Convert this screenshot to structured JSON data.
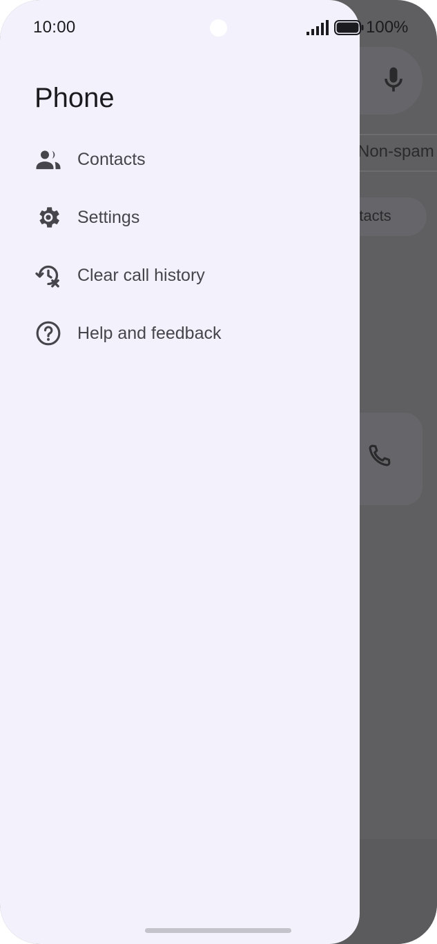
{
  "status_bar": {
    "time": "10:00",
    "battery": "100%",
    "icons": [
      "signal-icon",
      "battery-icon"
    ]
  },
  "background_app": {
    "filter_chip": "Non-spam",
    "contacts_chip": "ntacts",
    "icons": [
      "mic-icon",
      "phone-icon"
    ]
  },
  "drawer": {
    "title": "Phone",
    "items": [
      {
        "label": "Contacts",
        "icon": "contacts-icon"
      },
      {
        "label": "Settings",
        "icon": "gear-icon"
      },
      {
        "label": "Clear call history",
        "icon": "clear-history-icon"
      },
      {
        "label": "Help and feedback",
        "icon": "help-icon"
      }
    ]
  },
  "colors": {
    "drawer_bg": "#f3f1fb",
    "scrim": "#5f5f62",
    "text_primary": "#1b1b1f",
    "text_secondary": "#45454b",
    "icon": "#45454b"
  }
}
